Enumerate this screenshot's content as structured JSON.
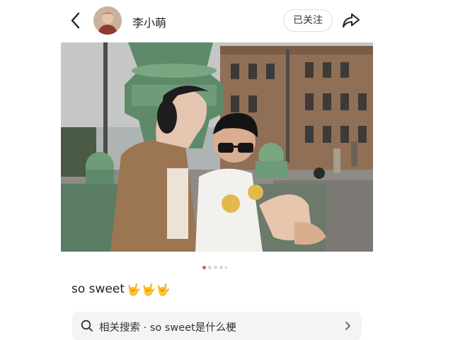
{
  "header": {
    "username": "李小萌",
    "follow_label": "已关注"
  },
  "post": {
    "carousel": {
      "count": 5,
      "active_index": 0
    },
    "caption": "so sweet",
    "caption_emojis": "🤟🤟🤟"
  },
  "related_search": {
    "label": "相关搜索 · so sweet是什么梗"
  },
  "colors": {
    "accent": "#f0524d",
    "related_bg": "#f4f4f5"
  }
}
